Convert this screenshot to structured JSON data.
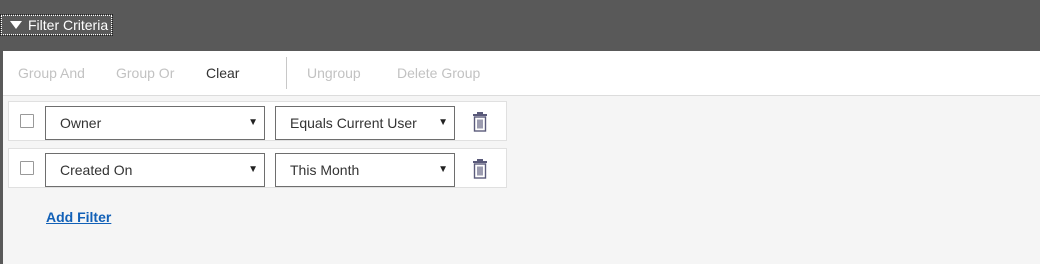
{
  "header": {
    "title": "Filter Criteria",
    "toggle_icon": "triangle-down-icon"
  },
  "toolbar": {
    "group_and": "Group And",
    "group_or": "Group Or",
    "clear": "Clear",
    "ungroup": "Ungroup",
    "delete_group": "Delete Group"
  },
  "filters": [
    {
      "field": "Owner",
      "operator": "Equals Current User",
      "checked": false
    },
    {
      "field": "Created On",
      "operator": "This Month",
      "checked": false
    }
  ],
  "add_filter": "Add Filter",
  "colors": {
    "header_bg": "#595959",
    "link": "#1160b7",
    "disabled_text": "#c2c2c2",
    "panel_bg": "#f5f5f5"
  }
}
